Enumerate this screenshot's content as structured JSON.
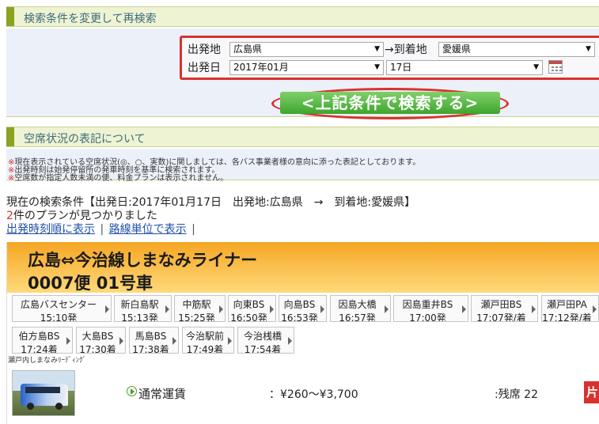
{
  "search": {
    "section_title": "検索条件を変更して再検索",
    "from_label": "出発地",
    "from_value": "広島県",
    "arrow_to": "→到着地",
    "to_value": "愛媛県",
    "date_label": "出発日",
    "month_value": "2017年01月",
    "day_value": "17日",
    "button_label": "<上記条件で検索する>"
  },
  "notes": {
    "section_title": "空席状況の表記について",
    "lines": [
      "現在表示されている空席状況(◎、○、実数)に関しましては、各バス事業者様の意向に添った表記としております。",
      "出発時刻は始発停留所の発車時刻を基準に検索されます。",
      "空席数が指定人数未満の便、料金プランは表示されません。"
    ]
  },
  "summary": {
    "condition_prefix": "現在の検索条件",
    "condition_detail": "【出発日:2017年01月17日　出発地:広島県　→　到着地:愛媛県】",
    "count": "2",
    "count_suffix": "件のプランが見つかりました",
    "link_time": "出発時刻順に表示",
    "separator": "|",
    "link_route": "路線単位で表示",
    "trailing": "|"
  },
  "route": {
    "name": "広島⇔今治線しまなみライナー",
    "trip": "0007便 01号車",
    "stops": [
      {
        "name": "広島バスセンター",
        "time": "15:10発"
      },
      {
        "name": "新白島駅",
        "time": "15:13発"
      },
      {
        "name": "中筋駅",
        "time": "15:25発"
      },
      {
        "name": "向東BS",
        "time": "16:50発"
      },
      {
        "name": "向島BS",
        "time": "16:53発"
      },
      {
        "name": "因島大橋",
        "time": "16:57発"
      },
      {
        "name": "因島重井BS",
        "time": "17:00発"
      },
      {
        "name": "瀬戸田BS",
        "time": "17:07発/着"
      },
      {
        "name": "瀬戸田PA",
        "time": "17:12発/着"
      },
      {
        "name": "伯方島BS",
        "time": "17:24着"
      },
      {
        "name": "大島BS",
        "time": "17:30着"
      },
      {
        "name": "馬島BS",
        "time": "17:38着"
      },
      {
        "name": "今治駅前",
        "time": "17:49着"
      },
      {
        "name": "今治桟橋",
        "time": "17:54着"
      }
    ],
    "operator": "瀬戸内しまなみﾘｰﾃﾞｨﾝｸﾞ",
    "fare_label": "通常運賃",
    "fare_value": "：¥260〜¥3,700",
    "seats": ":残席 22",
    "cut_button": "片"
  }
}
